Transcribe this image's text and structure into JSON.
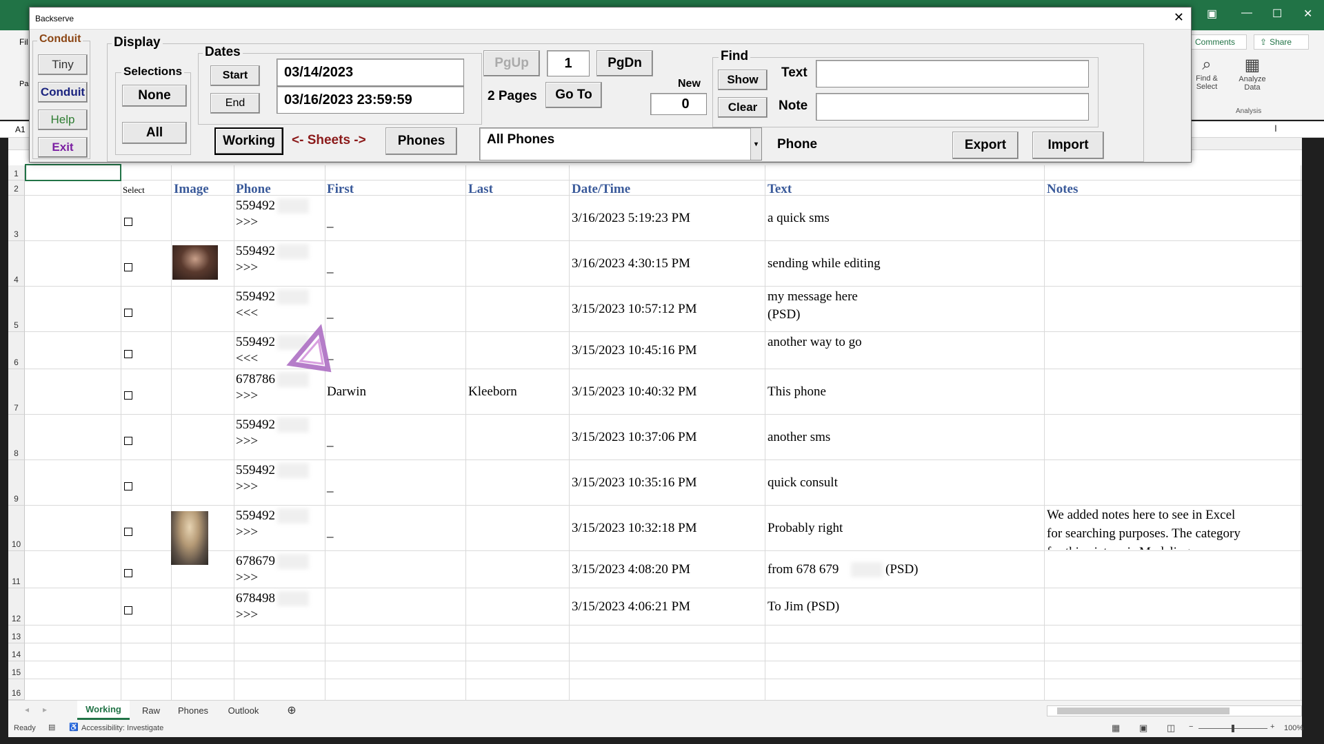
{
  "excel": {
    "ribbon_left_tab": "Fil",
    "ribbon_left_paste": "Pas",
    "name_box": "A1",
    "comments": "Comments",
    "share": "Share",
    "find_select": [
      "Find &",
      "Select"
    ],
    "analyze_data": [
      "Analyze",
      "Data"
    ],
    "analysis_group": "Analysis",
    "accent_color": "#217346"
  },
  "dialog": {
    "title": "Backserve",
    "conduit_group": "Conduit",
    "conduit_buttons": [
      "Tiny",
      "Conduit",
      "Help",
      "Exit"
    ],
    "conduit_button_colors": [
      "#333333",
      "#1a237e",
      "#2e7d32",
      "#7b1fa2"
    ],
    "display_group": "Display",
    "selections_group": "Selections",
    "none_button": "None",
    "all_button": "All",
    "dates_group": "Dates",
    "start_button": "Start",
    "end_button": "End",
    "start_date": "03/14/2023",
    "end_date": "03/16/2023 23:59:59",
    "pgup": "PgUp",
    "page_number": "1",
    "pgdn": "PgDn",
    "pages_label": "2 Pages",
    "goto": "Go To",
    "new_label": "New",
    "new_count": "0",
    "find_group": "Find",
    "show_button": "Show",
    "clear_button": "Clear",
    "text_label": "Text",
    "note_label": "Note",
    "working_button": "Working",
    "sheets_label": "<- Sheets ->",
    "phones_button": "Phones",
    "phone_filter": "All Phones",
    "phone_label": "Phone",
    "export_button": "Export",
    "import_button": "Import"
  },
  "sheet": {
    "row_numbers": [
      "1",
      "2",
      "3",
      "4",
      "5",
      "6",
      "7",
      "8",
      "9",
      "10",
      "11",
      "12",
      "13",
      "14",
      "15",
      "16"
    ],
    "headers": {
      "select": "Select",
      "image": "Image",
      "phone": "Phone",
      "first": "First",
      "last": "Last",
      "datetime": "Date/Time",
      "text": "Text",
      "notes": "Notes"
    },
    "rows": [
      {
        "phone": "559492",
        "dir": ">>>",
        "first": "_",
        "last": "",
        "datetime": "3/16/2023 5:19:23 PM",
        "text": "a quick sms",
        "text2": "",
        "notes": ""
      },
      {
        "phone": "559492",
        "dir": ">>>",
        "first": "_",
        "last": "",
        "datetime": "3/16/2023 4:30:15 PM",
        "text": "sending while editing",
        "text2": "",
        "notes": ""
      },
      {
        "phone": "559492",
        "dir": "<<<",
        "first": "_",
        "last": "",
        "datetime": "3/15/2023 10:57:12 PM",
        "text": "my message here",
        "text2": "(PSD)",
        "notes": ""
      },
      {
        "phone": "559492",
        "dir": "<<<",
        "first": "_",
        "last": "",
        "datetime": "3/15/2023 10:45:16 PM",
        "text": "another way to go",
        "text2": "",
        "notes": ""
      },
      {
        "phone": "678786",
        "dir": ">>>",
        "first": "Darwin",
        "last": "Kleeborn",
        "datetime": "3/15/2023 10:40:32 PM",
        "text": "This phone",
        "text2": "",
        "notes": ""
      },
      {
        "phone": "559492",
        "dir": ">>>",
        "first": "_",
        "last": "",
        "datetime": "3/15/2023 10:37:06 PM",
        "text": "another sms",
        "text2": "",
        "notes": ""
      },
      {
        "phone": "559492",
        "dir": ">>>",
        "first": "_",
        "last": "",
        "datetime": "3/15/2023 10:35:16 PM",
        "text": "quick consult",
        "text2": "",
        "notes": ""
      },
      {
        "phone": "559492",
        "dir": ">>>",
        "first": "_",
        "last": "",
        "datetime": "3/15/2023 10:32:18 PM",
        "text": "Probably right",
        "text2": "",
        "notes": "We added notes here to see in Excel\nfor searching purposes. The category\nfor this picture is Modeling"
      },
      {
        "phone": "678679",
        "dir": ">>>",
        "first": "",
        "last": "",
        "datetime": "3/15/2023 4:08:20 PM",
        "text": "from 678 679",
        "text2": "(PSD)",
        "notes": ""
      },
      {
        "phone": "678498",
        "dir": ">>>",
        "first": "",
        "last": "",
        "datetime": "3/15/2023 4:06:21 PM",
        "text": "To Jim (PSD)",
        "text2": "",
        "notes": ""
      }
    ],
    "tabs": [
      "Working",
      "Raw",
      "Phones",
      "Outlook"
    ],
    "active_tab": "Working"
  },
  "status": {
    "ready": "Ready",
    "accessibility": "Accessibility: Investigate",
    "zoom": "100%"
  }
}
